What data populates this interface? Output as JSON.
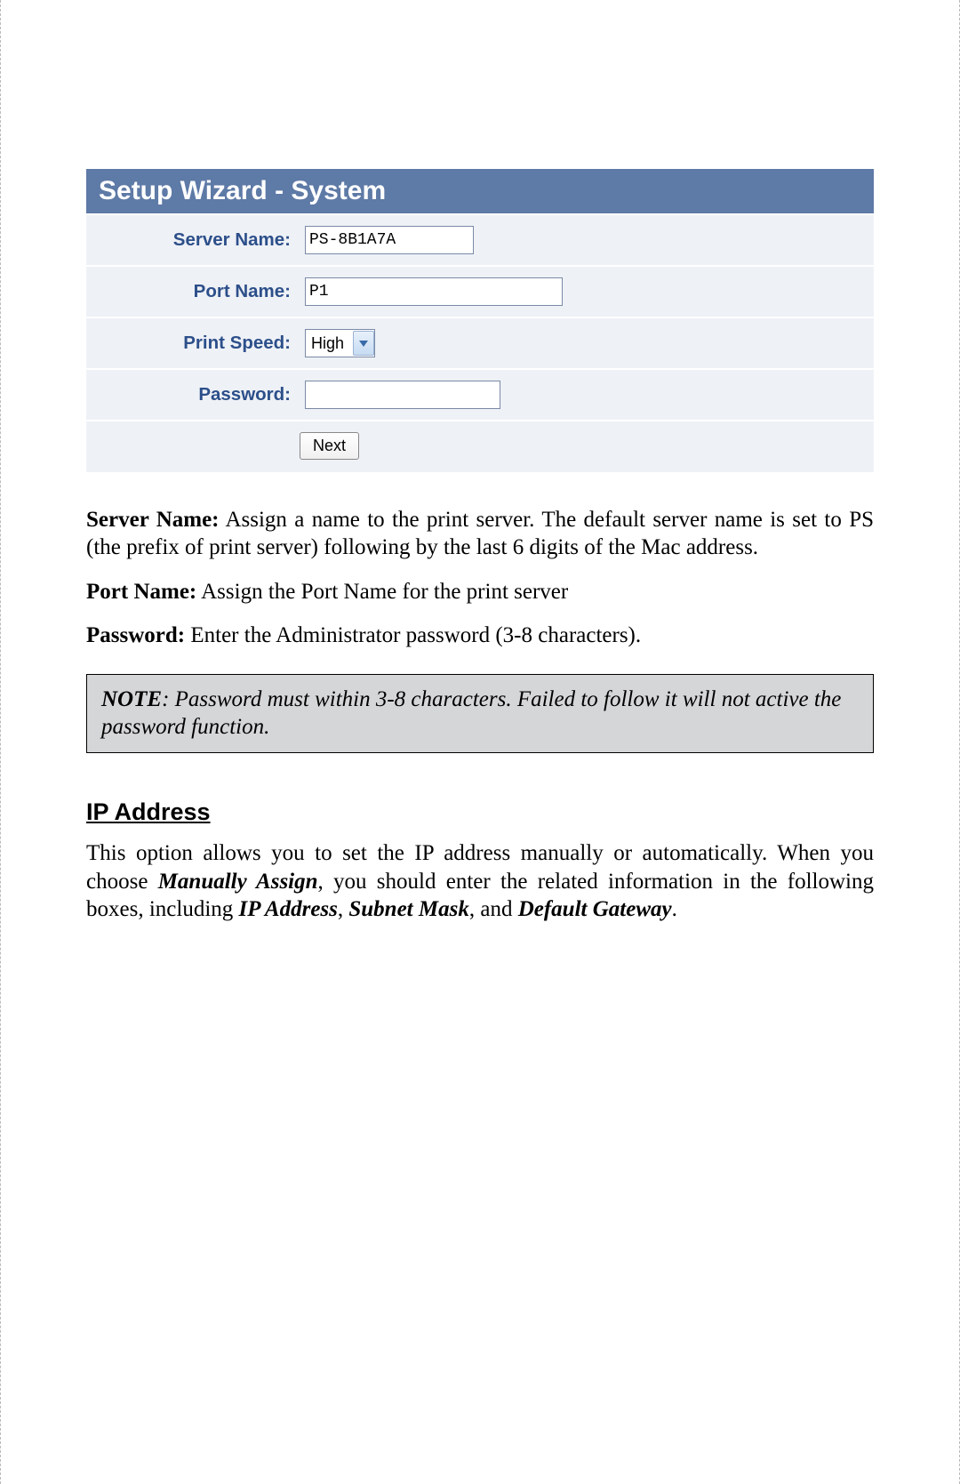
{
  "wizard": {
    "title": "Setup Wizard - System",
    "labels": {
      "server_name": "Server Name:",
      "port_name": "Port Name:",
      "print_speed": "Print Speed:",
      "password": "Password:"
    },
    "values": {
      "server_name": "PS-8B1A7A",
      "port_name": "P1",
      "print_speed": "High",
      "password": ""
    },
    "next_button": "Next"
  },
  "descriptions": {
    "server_name_label": "Server Name:",
    "server_name_text": " Assign a name to the print server. The default server name is set to PS (the prefix of print server) following by the last 6 digits of the Mac address.",
    "port_name_label": "Port Name:",
    "port_name_text": " Assign the Port Name for the print server",
    "password_label": "Password:",
    "password_text": " Enter the Administrator password (3-8 characters)."
  },
  "note": {
    "label": "NOTE",
    "text": ": Password must within 3-8 characters. Failed to follow it will not active the password function."
  },
  "ip_section": {
    "heading": "IP Address",
    "para_pre": "This option allows you to set the IP address manually or automatically. When you choose ",
    "manually_assign": "Manually Assign",
    "para_mid1": ", you should enter the related information in the following boxes, including ",
    "ip_address": "IP Address",
    "comma1": ", ",
    "subnet_mask": "Subnet Mask",
    "comma2": ", and ",
    "default_gateway": "Default Gateway",
    "period": "."
  }
}
